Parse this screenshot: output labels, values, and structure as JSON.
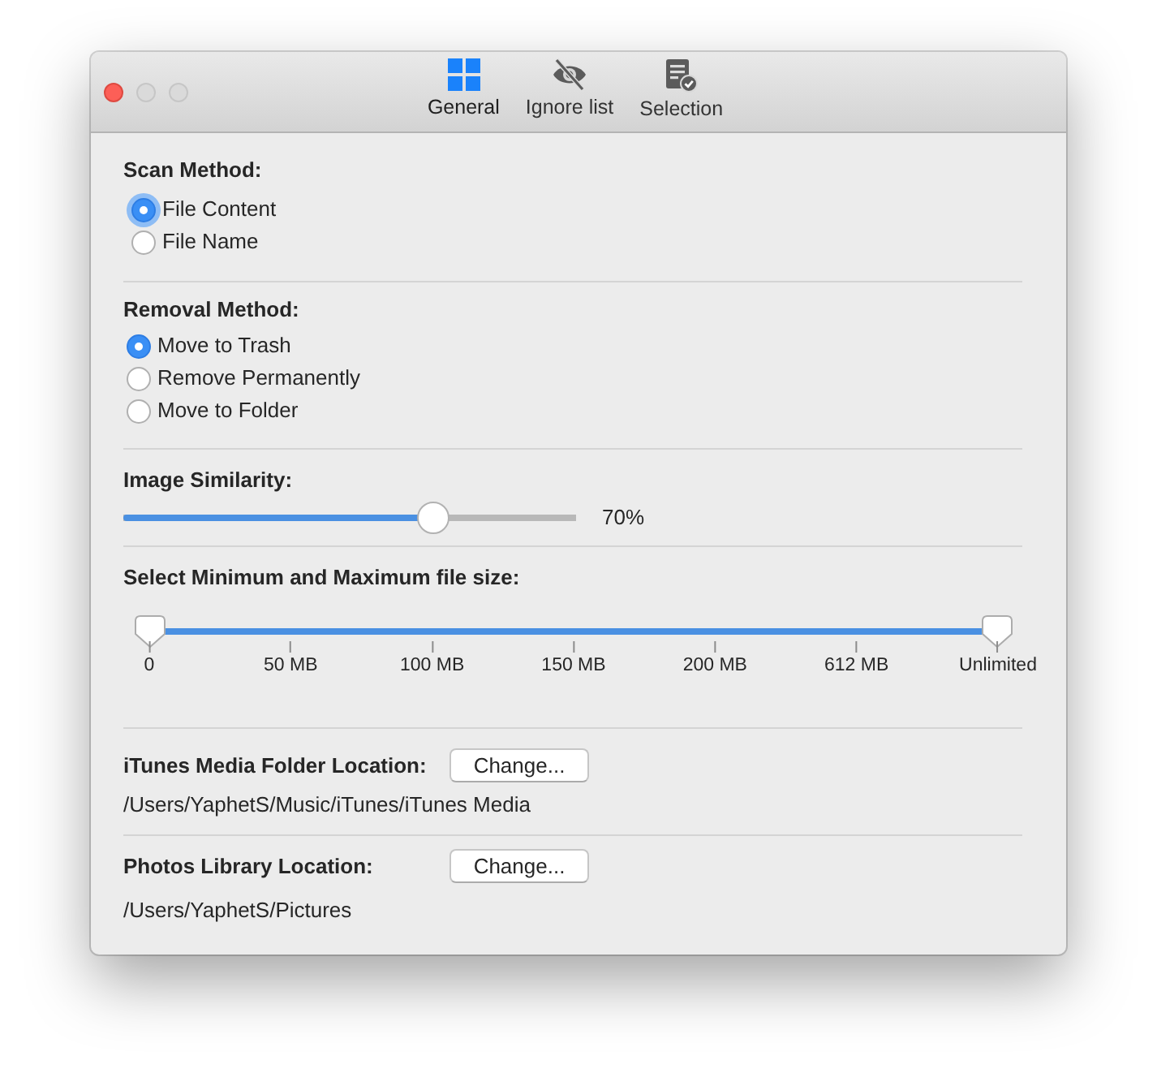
{
  "window": {
    "controls": [
      {
        "kind": "close",
        "enabled": true
      },
      {
        "kind": "minimize",
        "enabled": false
      },
      {
        "kind": "zoom",
        "enabled": false
      }
    ]
  },
  "toolbar": {
    "items": [
      {
        "kind": "general",
        "label": "General",
        "selected": true
      },
      {
        "kind": "ignore",
        "label": "Ignore list",
        "selected": false
      },
      {
        "kind": "selection",
        "label": "Selection",
        "selected": false
      }
    ]
  },
  "scan_method": {
    "title": "Scan Method:",
    "options": [
      {
        "label": "File Content",
        "selected": true,
        "focused": true
      },
      {
        "label": "File Name",
        "selected": false,
        "focused": false
      }
    ]
  },
  "removal_method": {
    "title": "Removal Method:",
    "options": [
      {
        "label": "Move to Trash",
        "selected": true,
        "focused": false
      },
      {
        "label": "Remove Permanently",
        "selected": false,
        "focused": false
      },
      {
        "label": "Move to Folder",
        "selected": false,
        "focused": false
      }
    ]
  },
  "image_similarity": {
    "title": "Image Similarity:",
    "level": 0.7,
    "reading": "70%"
  },
  "file_size": {
    "title": "Select Minimum and Maximum file size:",
    "thumbs": [
      {
        "level": 0
      },
      {
        "level": 1
      }
    ],
    "ticks": [
      "0",
      "50 MB",
      "100 MB",
      "150 MB",
      "200 MB",
      "612 MB",
      "Unlimited"
    ]
  },
  "locations": [
    {
      "title": "iTunes Media Folder Location:",
      "button": "Change...",
      "path": "/Users/YaphetS/Music/iTunes/iTunes Media"
    },
    {
      "title": "Photos Library Location:",
      "button": "Change...",
      "path": "/Users/YaphetS/Pictures"
    }
  ]
}
